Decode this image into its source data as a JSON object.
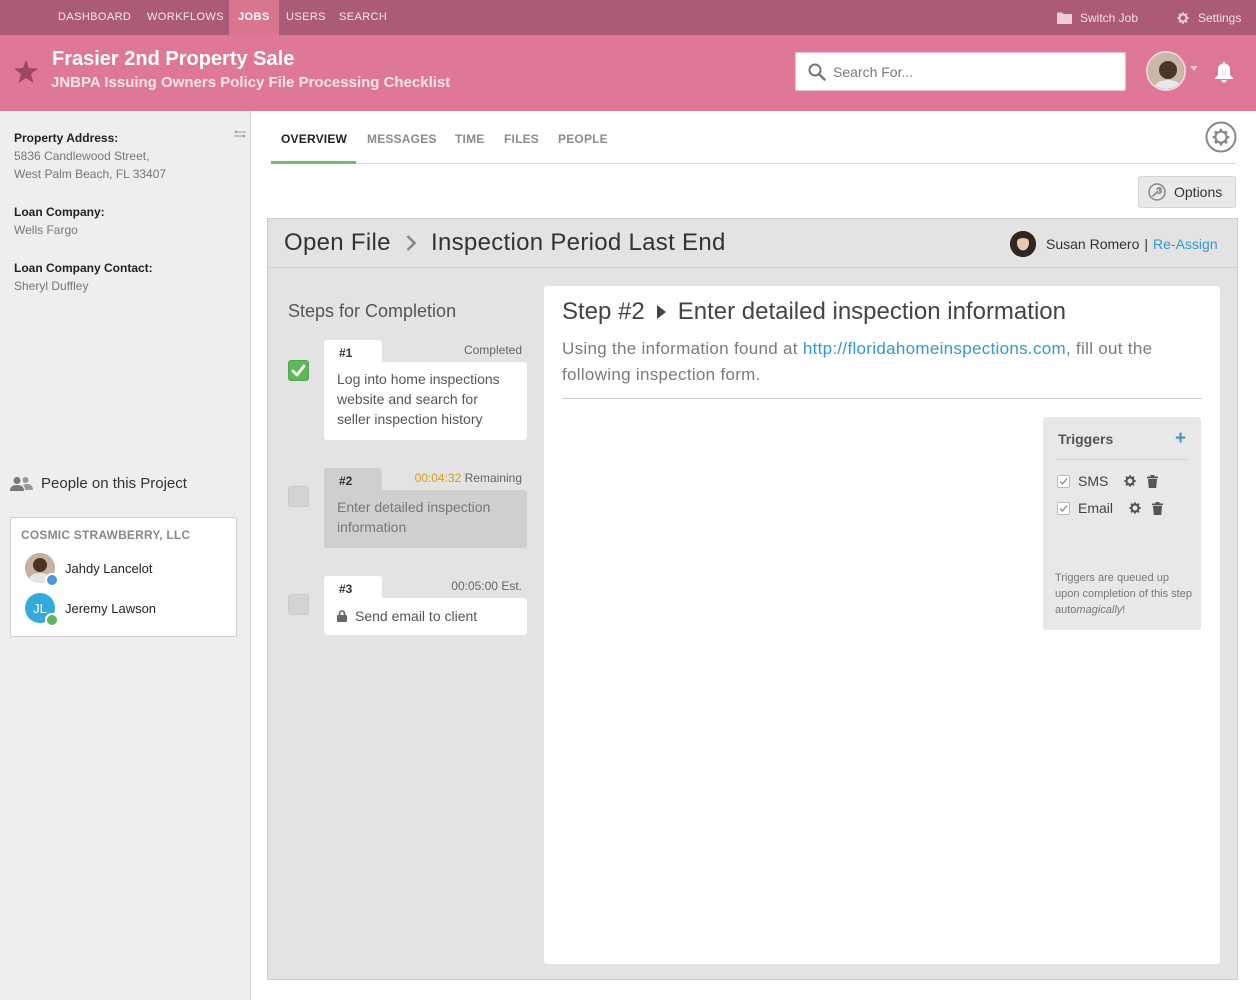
{
  "topnav": {
    "items": [
      "DASHBOARD",
      "WORKFLOWS",
      "JOBS",
      "USERS",
      "SEARCH"
    ],
    "active": "JOBS",
    "switch_job": "Switch Job",
    "settings": "Settings"
  },
  "header": {
    "title": "Frasier 2nd Property Sale",
    "subtitle": "JNBPA Issuing Owners Policy File Processing Checklist",
    "search_placeholder": "Search For..."
  },
  "sidebar": {
    "property_label": "Property Address:",
    "property_line1": "5836 Candlewood Street,",
    "property_line2": "West Palm Beach, FL 33407",
    "loan_company_label": "Loan Company:",
    "loan_company": "Wells Fargo",
    "loan_contact_label": "Loan Company Contact:",
    "loan_contact": "Sheryl Duffley",
    "people_title": "People on this Project",
    "company": "COSMIC STRAWBERRY, LLC",
    "people": [
      {
        "name": "Jahdy Lancelot"
      },
      {
        "name": "Jeremy Lawson",
        "initials": "JL"
      }
    ]
  },
  "tabs": [
    "OVERVIEW",
    "MESSAGES",
    "TIME",
    "FILES",
    "PEOPLE"
  ],
  "active_tab": "OVERVIEW",
  "options_label": "Options",
  "panel": {
    "crumb_from": "Open File",
    "crumb_to": "Inspection Period Last End",
    "assignee": "Susan Romero",
    "separator": "|",
    "reassign": "Re-Assign",
    "steps_title": "Steps for Completion",
    "steps": [
      {
        "num": "#1",
        "status": "Completed",
        "text": "Log into home inspections website and search for seller inspection history",
        "checked": true
      },
      {
        "num": "#2",
        "time": "00:04:32",
        "status": "Remaining",
        "text": "Enter detailed inspection information",
        "checked": false
      },
      {
        "num": "#3",
        "time": "00:05:00",
        "status": "Est.",
        "text": "Send email to client",
        "checked": false
      }
    ],
    "detail": {
      "step_label": "Step #2",
      "title": "Enter detailed inspection information",
      "desc_before": "Using the information found at ",
      "link": "http://floridahomeinspections.com",
      "desc_after": ", fill out the following inspection form."
    },
    "triggers": {
      "title": "Triggers",
      "add": "+",
      "items": [
        "SMS",
        "Email"
      ],
      "note_before": "Triggers are queued up upon completion of this step auto",
      "note_em": "magically",
      "note_after": "!"
    }
  },
  "colors": {
    "nav_bg": "#ab5b76",
    "banner_bg": "#de7896",
    "accent_green": "#5db85c",
    "link_blue": "#3399cc",
    "timer_orange": "#d4a017"
  }
}
